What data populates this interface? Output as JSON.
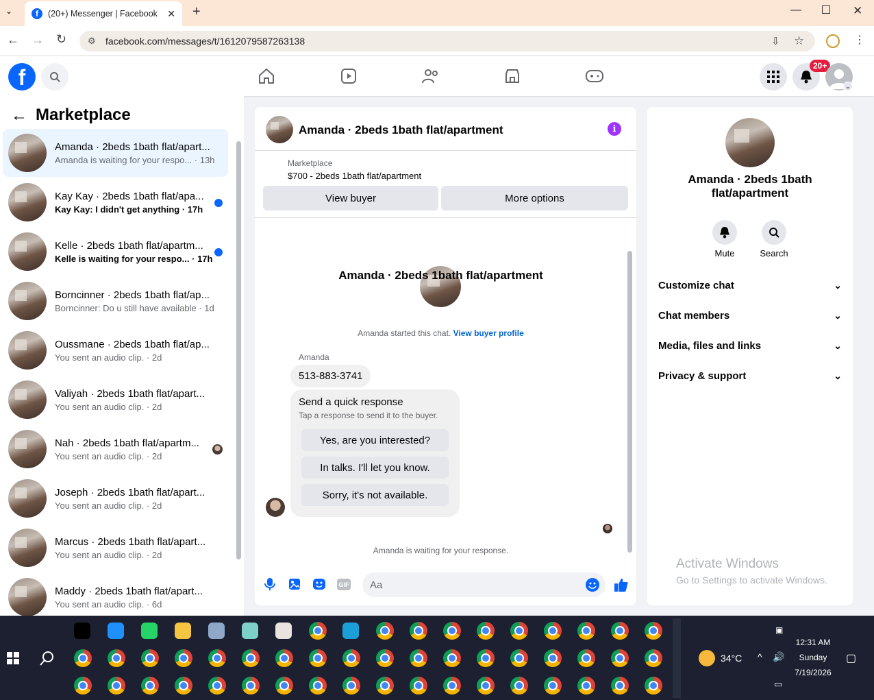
{
  "browser": {
    "tab_title": "(20+) Messenger | Facebook",
    "url": "facebook.com/messages/t/1612079587263138"
  },
  "nav": {
    "notifications_badge": "20+"
  },
  "sidebar": {
    "title": "Marketplace",
    "conversations": [
      {
        "name": "Amanda · 2beds 1bath flat/apart...",
        "preview": "Amanda is waiting for your respo...",
        "time": "· 13h"
      },
      {
        "name": "Kay Kay · 2beds 1bath flat/apa...",
        "preview": "Kay Kay: I didn't get anything",
        "time": "· 17h"
      },
      {
        "name": "Kelle · 2beds 1bath flat/apartm...",
        "preview": "Kelle is waiting for your respo...",
        "time": "· 17h"
      },
      {
        "name": "Borncinner · 2beds 1bath flat/ap...",
        "preview": "Borncinner: Do u still have available",
        "time": "· 1d"
      },
      {
        "name": "Oussmane · 2beds 1bath flat/ap...",
        "preview": "You sent an audio clip.",
        "time": "· 2d"
      },
      {
        "name": "Valiyah · 2beds 1bath flat/apart...",
        "preview": "You sent an audio clip.",
        "time": "· 2d"
      },
      {
        "name": "Nah · 2beds 1bath flat/apartm...",
        "preview": "You sent an audio clip.",
        "time": "· 2d"
      },
      {
        "name": "Joseph · 2beds 1bath flat/apart...",
        "preview": "You sent an audio clip.",
        "time": "· 2d"
      },
      {
        "name": "Marcus · 2beds 1bath flat/apart...",
        "preview": "You sent an audio clip.",
        "time": "· 2d"
      },
      {
        "name": "Maddy · 2beds 1bath flat/apart...",
        "preview": "You sent an audio clip.",
        "time": "· 6d"
      }
    ]
  },
  "chat": {
    "header_title": "Amanda · 2beds 1bath flat/apartment",
    "listing_source": "Marketplace",
    "listing_title": "$700 - 2beds 1bath flat/apartment",
    "view_buyer": "View buyer",
    "more_options": "More options",
    "intro_name": "Amanda · 2beds 1bath flat/apartment",
    "started_text": "Amanda started this chat.",
    "view_profile": "View buyer profile",
    "sender": "Amanda",
    "message": "513-883-3741",
    "quick_title": "Send a quick response",
    "quick_sub": "Tap a response to send it to the buyer.",
    "quick_responses": [
      "Yes, are you interested?",
      "In talks. I'll let you know.",
      "Sorry, it's not available."
    ],
    "waiting": "Amanda is waiting for your response.",
    "input_placeholder": "Aa"
  },
  "info": {
    "name": "Amanda · 2beds 1bath flat/apartment",
    "mute": "Mute",
    "search": "Search",
    "sections": [
      "Customize chat",
      "Chat members",
      "Media, files and links",
      "Privacy & support"
    ],
    "watermark_title": "Activate Windows",
    "watermark_sub": "Go to Settings to activate Windows."
  },
  "taskbar": {
    "temp": "34°C",
    "time": "12:31 AM",
    "day": "Sunday",
    "date": "7/19/2026"
  },
  "colors": {
    "accent": "#0866ff",
    "info": "#a033ff",
    "notify": "#e41e3f"
  }
}
